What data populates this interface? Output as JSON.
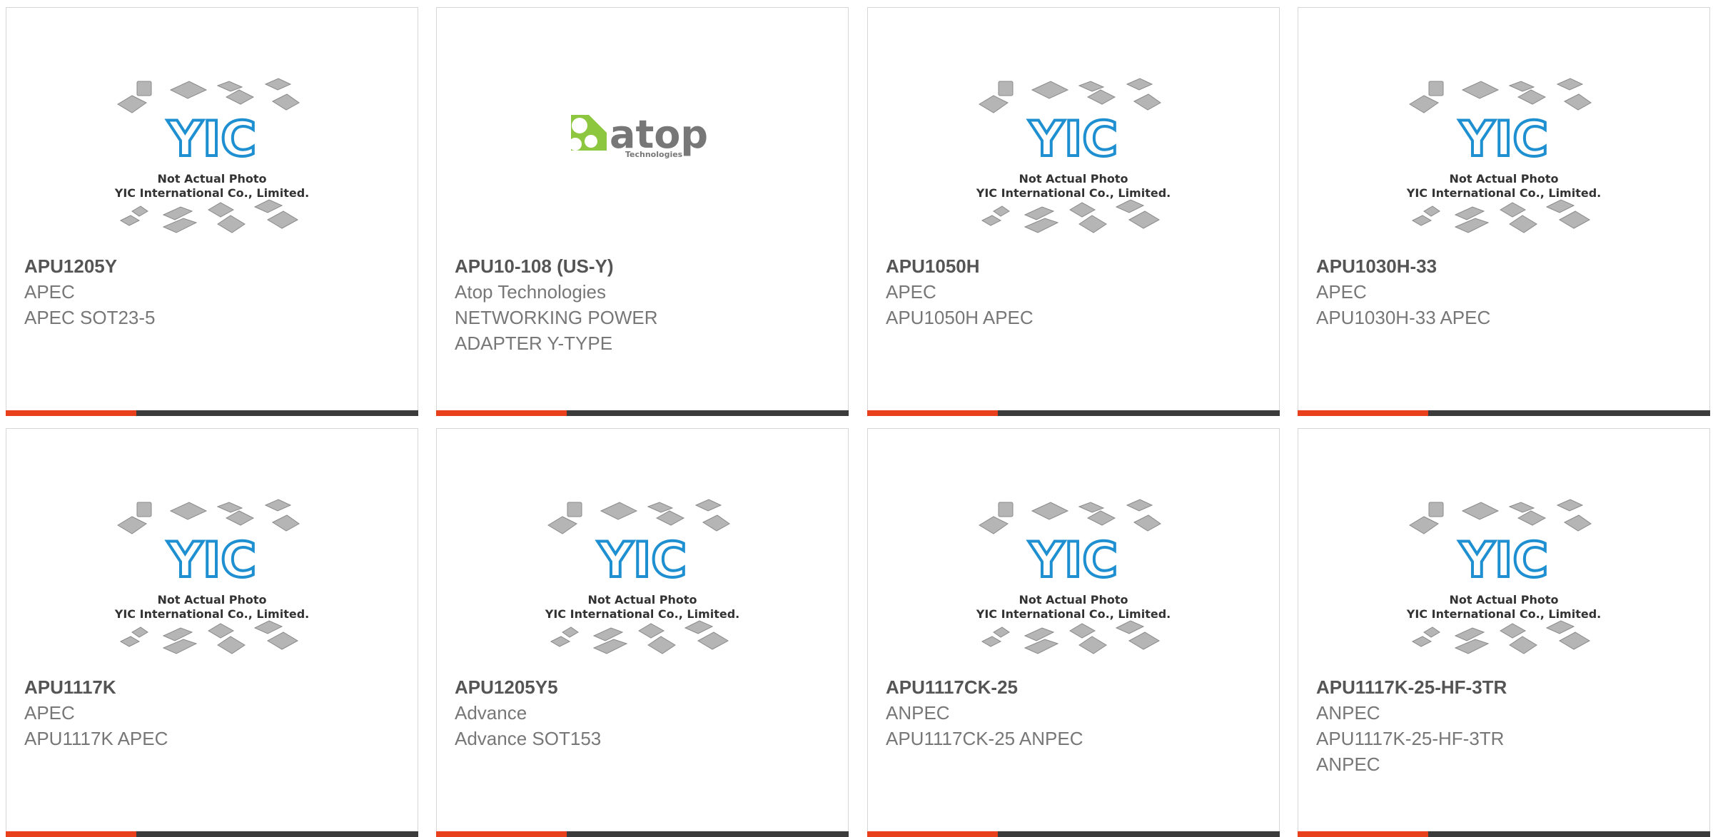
{
  "products": [
    {
      "part_number": "APU1205Y",
      "manufacturer": "APEC",
      "description": "APEC SOT23-5",
      "image": "yic-placeholder"
    },
    {
      "part_number": "APU10-108 (US-Y)",
      "manufacturer": "Atop Technologies",
      "description": "NETWORKING POWER ADAPTER Y-TYPE",
      "image": "atop-logo"
    },
    {
      "part_number": "APU1050H",
      "manufacturer": "APEC",
      "description": "APU1050H APEC",
      "image": "yic-placeholder"
    },
    {
      "part_number": "APU1030H-33",
      "manufacturer": "APEC",
      "description": "APU1030H-33 APEC",
      "image": "yic-placeholder"
    },
    {
      "part_number": "APU1117K",
      "manufacturer": "APEC",
      "description": "APU1117K APEC",
      "image": "yic-placeholder"
    },
    {
      "part_number": "APU1205Y5",
      "manufacturer": "Advance",
      "description": "Advance SOT153",
      "image": "yic-placeholder"
    },
    {
      "part_number": "APU1117CK-25",
      "manufacturer": "ANPEC",
      "description": "APU1117CK-25 ANPEC",
      "image": "yic-placeholder"
    },
    {
      "part_number": "APU1117K-25-HF-3TR",
      "manufacturer": "ANPEC",
      "description": "APU1117K-25-HF-3TR ANPEC",
      "image": "yic-placeholder"
    }
  ],
  "placeholder": {
    "logo_text": "YIC",
    "line1": "Not Actual Photo",
    "line2": "YIC International Co., Limited."
  },
  "atop_logo": {
    "name": "atop",
    "tagline": "Technologies"
  },
  "colors": {
    "accent": "#e8401c",
    "bar": "#3b3b3b",
    "yic_blue": "#1e8fd0",
    "atop_green": "#8dc63f",
    "atop_gray": "#777777"
  }
}
